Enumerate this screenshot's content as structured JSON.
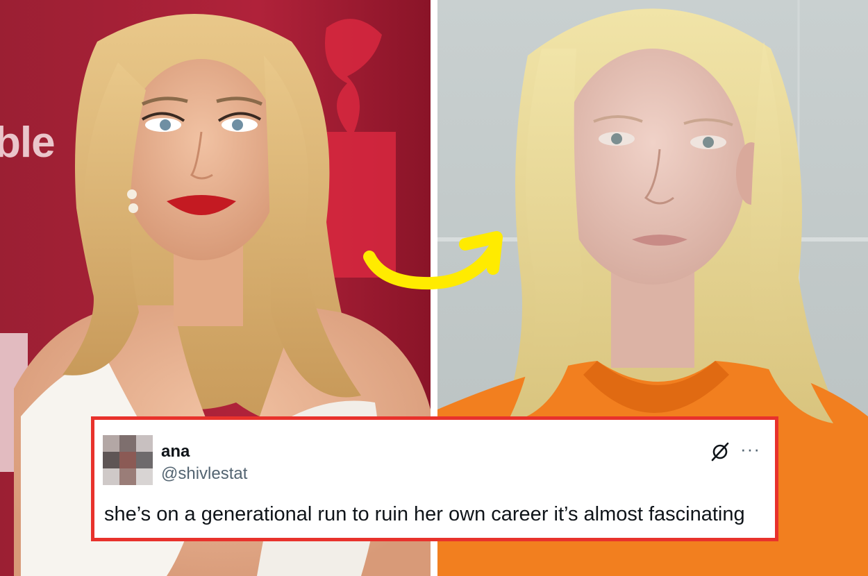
{
  "images": {
    "left": {
      "description_icon": "red-carpet-photo",
      "backdrop_text": "ble"
    },
    "right": {
      "description_icon": "mugshot-photo"
    }
  },
  "arrow": {
    "icon": "curved-arrow-icon",
    "color": "#ffeb00"
  },
  "tweet": {
    "name": "ana",
    "handle": "@shivlestat",
    "text": "she’s on a generational run to ruin her own career it’s almost fascinating",
    "logo_icon": "x-grok-icon",
    "more_label": "···",
    "border_color": "#e8322c"
  }
}
